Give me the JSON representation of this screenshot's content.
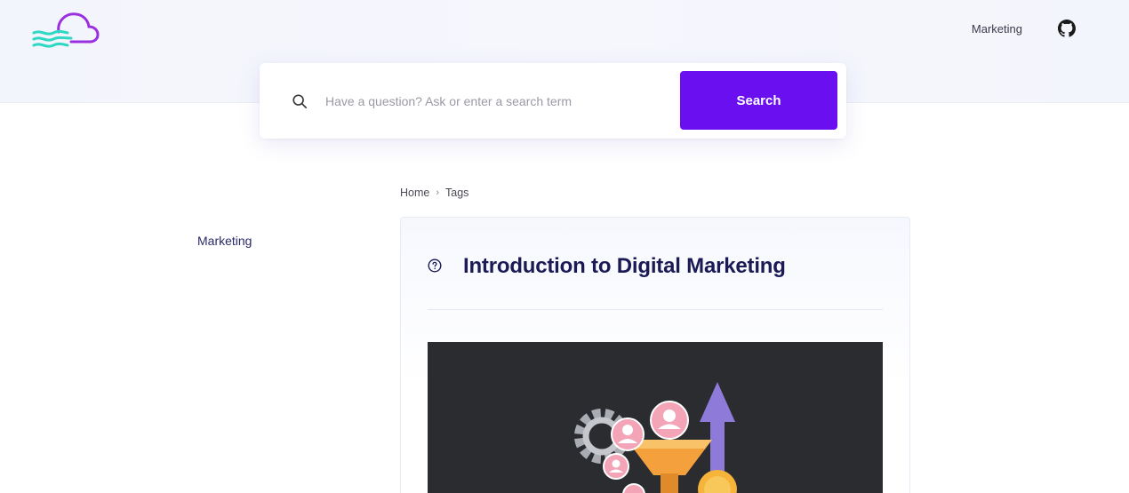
{
  "header": {
    "logo_icon": "cloud-logo-icon",
    "nav": {
      "marketing_label": "Marketing",
      "github_icon": "github-icon"
    }
  },
  "search": {
    "placeholder": "Have a question? Ask or enter a search term",
    "value": "",
    "button_label": "Search",
    "icon": "search-icon"
  },
  "sidebar": {
    "items": [
      {
        "label": "Marketing"
      }
    ]
  },
  "breadcrumb": {
    "items": [
      {
        "label": "Home"
      },
      {
        "label": "Tags"
      }
    ],
    "separator": "›"
  },
  "article": {
    "icon": "question-circle-icon",
    "title": "Introduction to Digital Marketing",
    "image": "digital-marketing-illustration"
  },
  "colors": {
    "accent": "#6a0ff0",
    "title": "#1b1a55",
    "logo_purple": "#8a2be2",
    "logo_teal": "#2ed8c3",
    "image_bg": "#2b2c30"
  }
}
